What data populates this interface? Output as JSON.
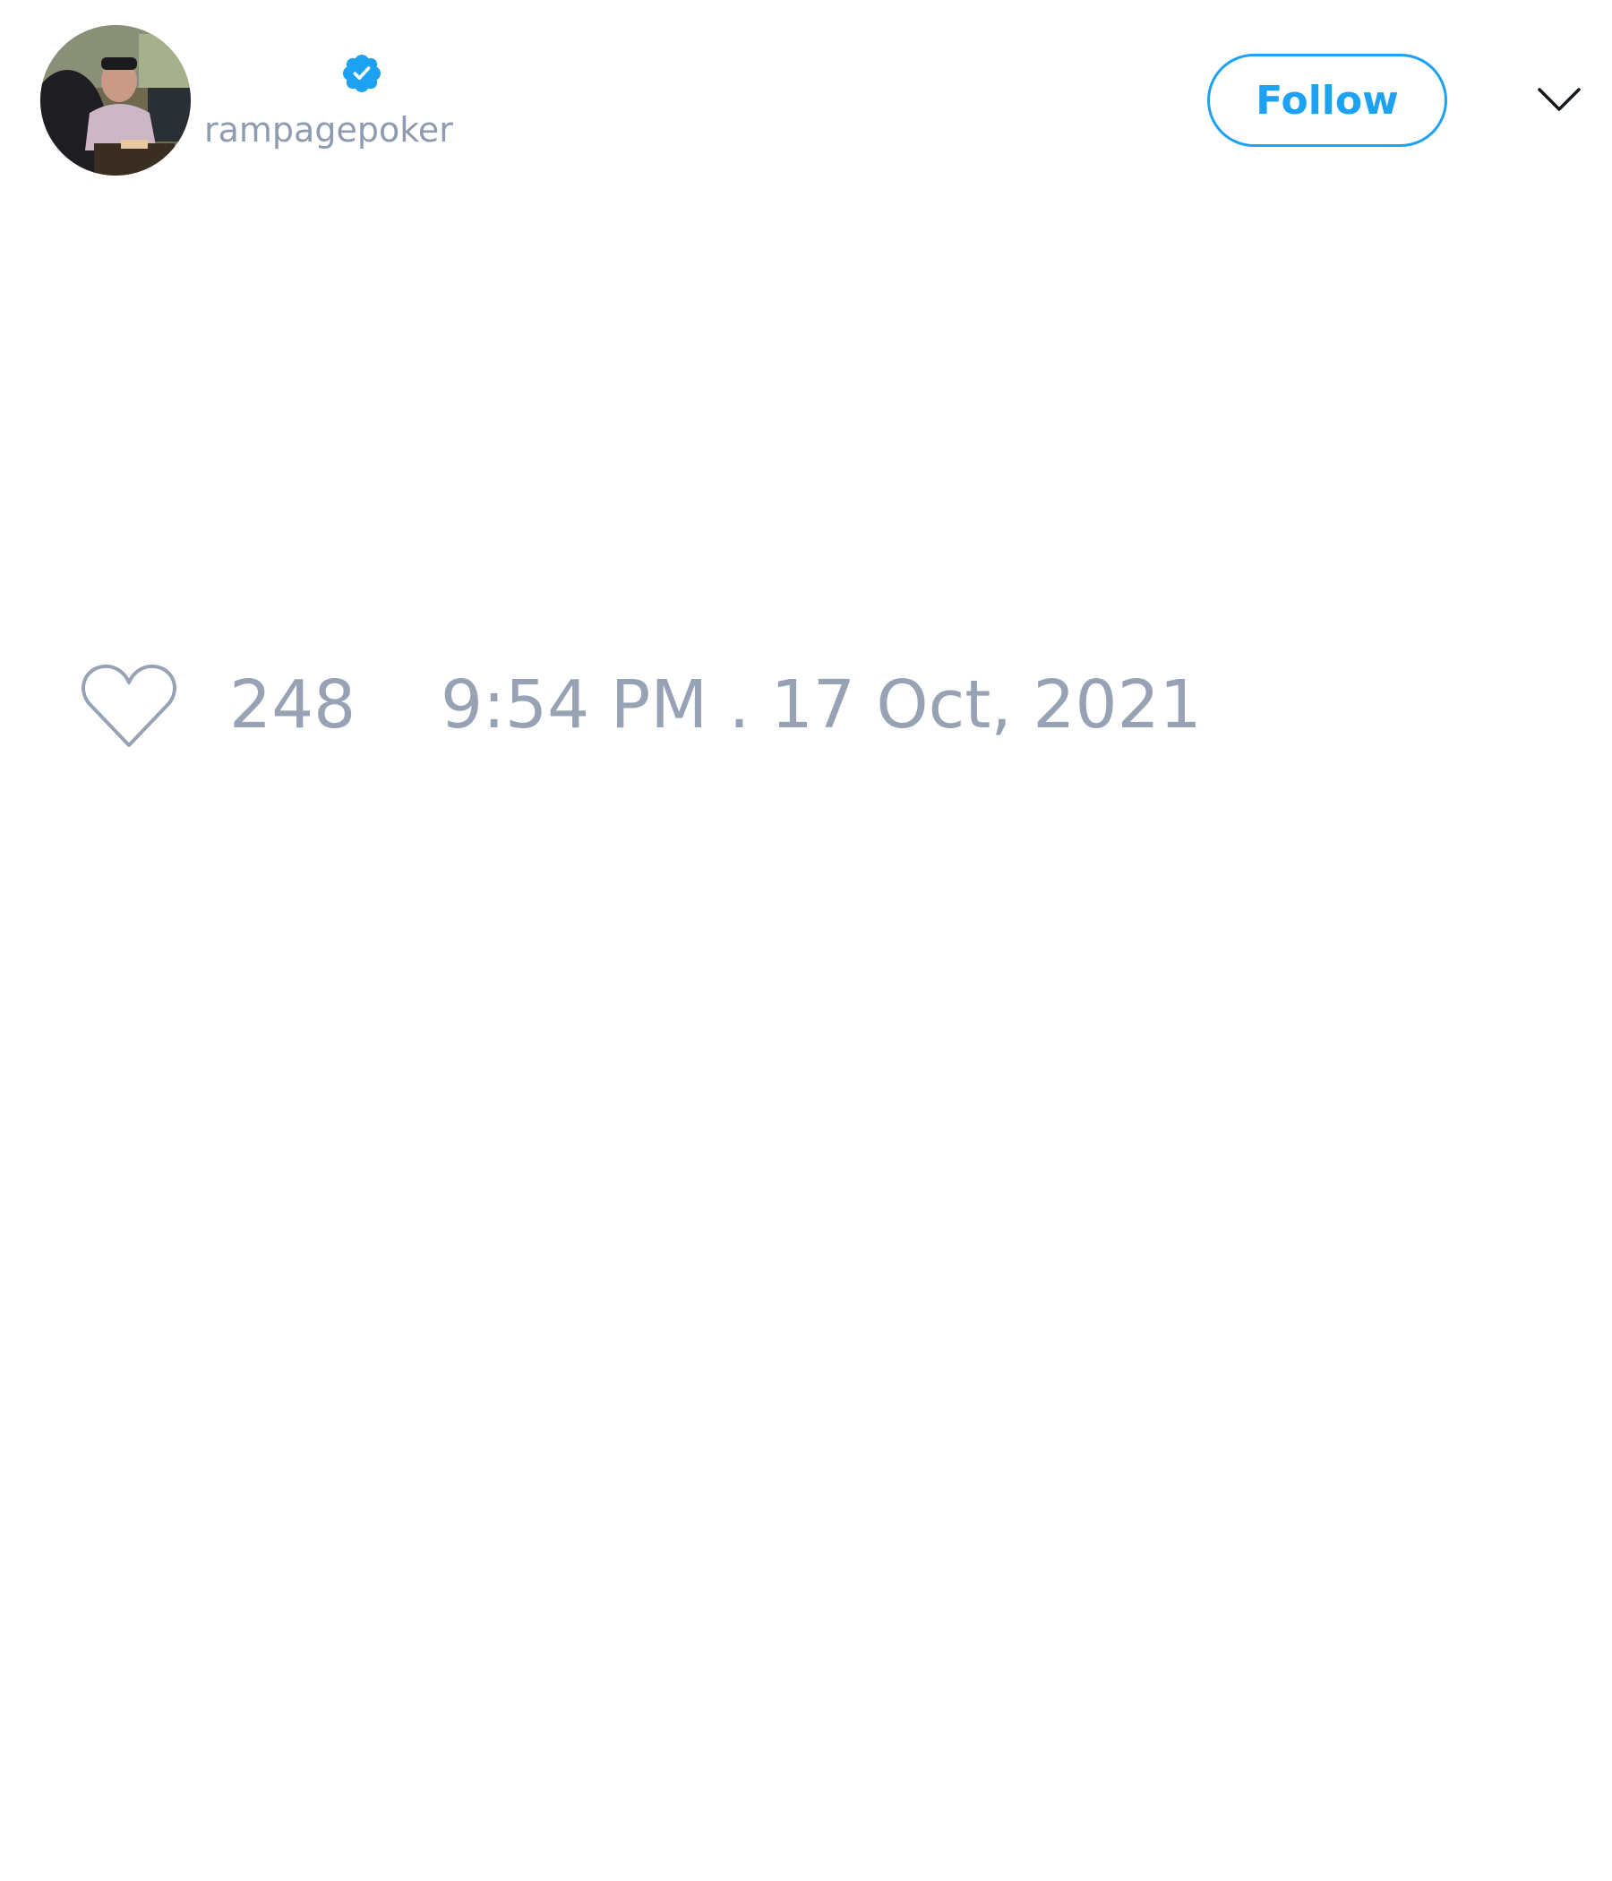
{
  "tweet": {
    "author": {
      "handle": "rampagepoker",
      "verified_icon": "verified-badge-icon",
      "avatar_icon": "user-avatar"
    },
    "follow_label": "Follow",
    "menu_icon": "chevron-down-icon",
    "likes": {
      "icon": "heart-icon",
      "count": "248"
    },
    "timestamp": "9:54 PM . 17 Oct, 2021"
  },
  "colors": {
    "accent": "#1da1f2",
    "muted_text": "#97a3b5",
    "background": "#ffffff"
  }
}
